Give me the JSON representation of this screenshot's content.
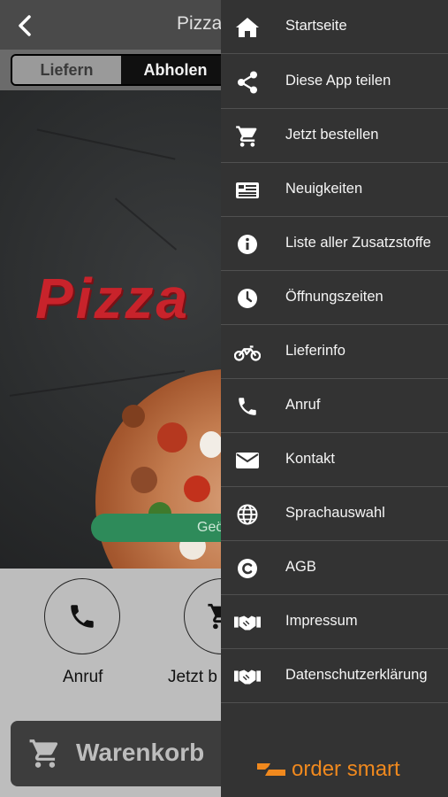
{
  "header": {
    "title": "Pizza",
    "back_icon": "chevron-left-icon"
  },
  "mode_toggle": {
    "options": [
      "Liefern",
      "Abholen"
    ],
    "selected": "Abholen"
  },
  "hero": {
    "logo_text": "Pizza",
    "status_button_text": "Geö"
  },
  "quick_actions": [
    {
      "label": "Anruf",
      "icon": "phone-icon"
    },
    {
      "label": "Jetzt b",
      "icon": "cart-icon"
    }
  ],
  "cart": {
    "label": "Warenkorb",
    "icon": "cart-icon"
  },
  "drawer": {
    "items": [
      {
        "label": "Startseite",
        "icon": "home-icon"
      },
      {
        "label": "Diese App teilen",
        "icon": "share-icon"
      },
      {
        "label": "Jetzt bestellen",
        "icon": "cart-icon"
      },
      {
        "label": "Neuigkeiten",
        "icon": "news-icon"
      },
      {
        "label": "Liste aller Zusatzstoffe",
        "icon": "info-icon"
      },
      {
        "label": "Öffnungszeiten",
        "icon": "clock-icon"
      },
      {
        "label": "Lieferinfo",
        "icon": "motorbike-icon"
      },
      {
        "label": "Anruf",
        "icon": "phone-icon"
      },
      {
        "label": "Kontakt",
        "icon": "envelope-icon"
      },
      {
        "label": "Sprachauswahl",
        "icon": "globe-icon"
      },
      {
        "label": "AGB",
        "icon": "copyright-icon"
      },
      {
        "label": "Impressum",
        "icon": "handshake-icon"
      },
      {
        "label": "Datenschutzerklärung",
        "icon": "handshake-icon"
      }
    ],
    "brand": "order smart"
  },
  "colors": {
    "drawer_bg": "#333333",
    "accent_red": "#c8232b",
    "brand_orange": "#f0891e",
    "status_green": "#2e8b5a"
  }
}
